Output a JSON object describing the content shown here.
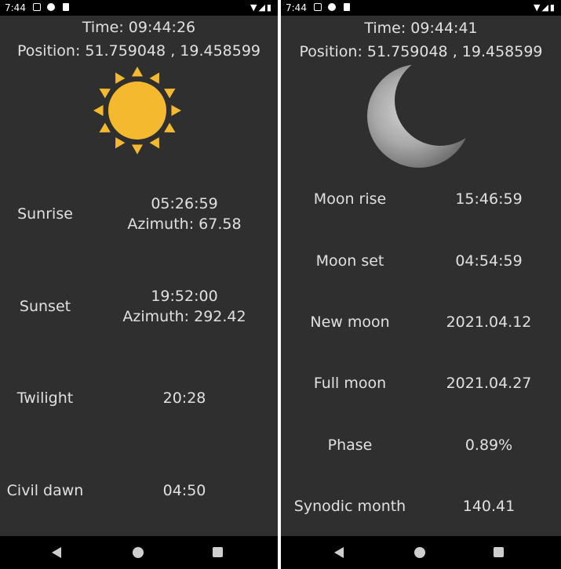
{
  "left": {
    "status_time": "7:44",
    "time_line": "Time: 09:44:26",
    "position_line": "Position: 51.759048 , 19.458599",
    "rows": [
      {
        "label": "Sunrise",
        "value1": "05:26:59",
        "value2": "Azimuth: 67.58"
      },
      {
        "label": "Sunset",
        "value1": "19:52:00",
        "value2": "Azimuth: 292.42"
      },
      {
        "label": "Twilight",
        "value1": "20:28",
        "value2": ""
      },
      {
        "label": "Civil dawn",
        "value1": "04:50",
        "value2": ""
      }
    ]
  },
  "right": {
    "status_time": "7:44",
    "time_line": "Time: 09:44:41",
    "position_line": "Position: 51.759048 , 19.458599",
    "rows": [
      {
        "label": "Moon rise",
        "value": "15:46:59"
      },
      {
        "label": "Moon set",
        "value": "04:54:59"
      },
      {
        "label": "New moon",
        "value": "2021.04.12"
      },
      {
        "label": "Full moon",
        "value": "2021.04.27"
      },
      {
        "label": "Phase",
        "value": "0.89%"
      },
      {
        "label": "Synodic month",
        "value": "140.41"
      }
    ]
  },
  "colors": {
    "sun": "#f5b92f",
    "background": "#2f2f2f",
    "text": "#e0e0e0"
  },
  "icons": {
    "sun": "sun-icon",
    "moon": "moon-crescent-icon"
  }
}
